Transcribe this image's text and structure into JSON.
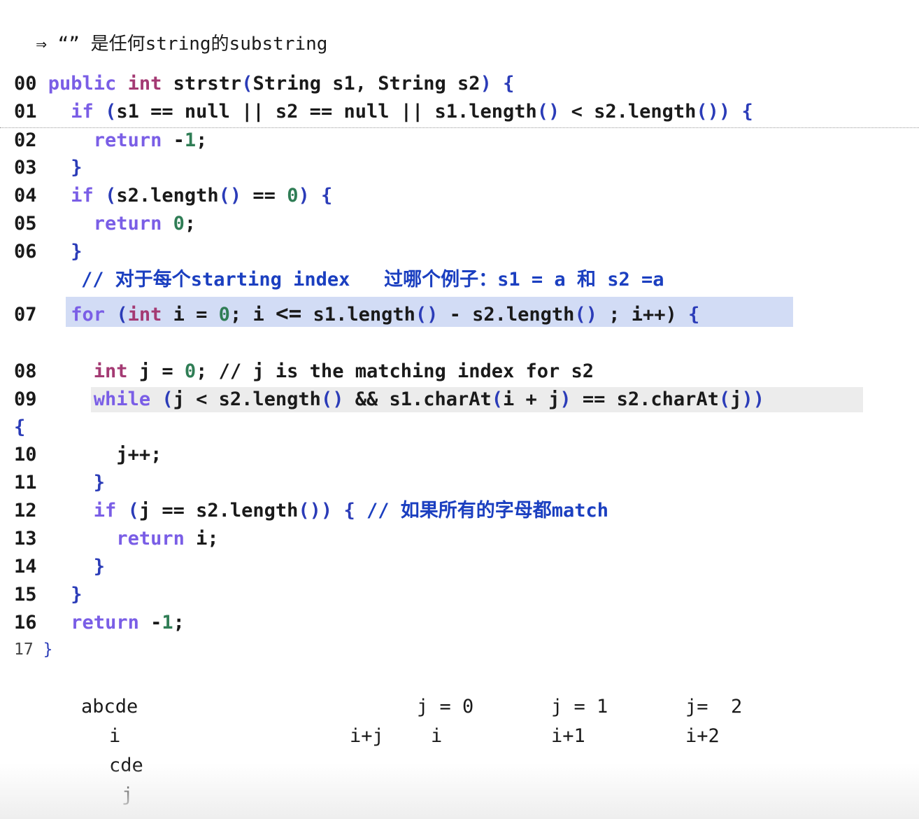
{
  "header": {
    "arrow": "⇒",
    "quotes": "“”",
    "zh1": "是任何",
    "w1": "string",
    "zh2": "的",
    "w2": "substring"
  },
  "lines": {
    "n00": "00",
    "n01": "01",
    "n02": "02",
    "n03": "03",
    "n04": "04",
    "n05": "05",
    "n06": "06",
    "n07": "07",
    "n08": "08",
    "n09": "09",
    "n10": "10",
    "n11": "11",
    "n12": "12",
    "n13": "13",
    "n14": "14",
    "n15": "15",
    "n16": "16",
    "n17": "17"
  },
  "code": {
    "public": "public",
    "int": "int",
    "sig_a": "strstr",
    "sig_b": "String s1, String s2",
    "if": "if",
    "null": "null",
    "return": "return",
    "for": "for",
    "while": "while",
    "c01": "s1 == null || s2 == null || s1.length",
    "c01b": " < s2.length",
    "m1": "-1",
    "c04": "s2.length",
    "zero": "0",
    "c07a": " i = ",
    "c07b": "; i ",
    "c07c": " s1.length",
    "c07d": " - s2.length",
    "c07e": " ; i++",
    "lte": "<=",
    "c08a": " j = ",
    "c08b": "; // j is the matching index for s2",
    "c09a": "j < s2.length",
    "c09b": " && s1.charAt",
    "c09c": "i + j",
    "c09d": " == s2.charAt",
    "c09e": "j",
    "c10": "j++;",
    "c12a": "j == s2.length",
    "c12b": "// ",
    "c12zh": "如果所有的字母都",
    "c12w": "match",
    "c13": " i;",
    "c16": " -1;",
    "comment_prefix": "// ",
    "comment_zh1": "对于每个",
    "comment_w1": "starting index",
    "comment_zh2": "过哪个例子：",
    "comment_w2": "s1 = a ",
    "comment_zh3": "和",
    "comment_w3": " s2 =a"
  },
  "notes": {
    "abcde": "abcde",
    "i": "i",
    "cde": "cde",
    "j": "j",
    "ipj": "i+j",
    "j0": "j = 0",
    "i_under": "i",
    "j1": "j = 1",
    "ip1": "i+1",
    "j2": "j=  2",
    "ip2": "i+2"
  },
  "colors": {
    "keyword": "#7a5ee6",
    "type": "#a43a73",
    "number": "#2f7d55",
    "punct": "#2b3cb8",
    "comment": "#1b3fc0",
    "highlight": "#d2dcf5"
  }
}
